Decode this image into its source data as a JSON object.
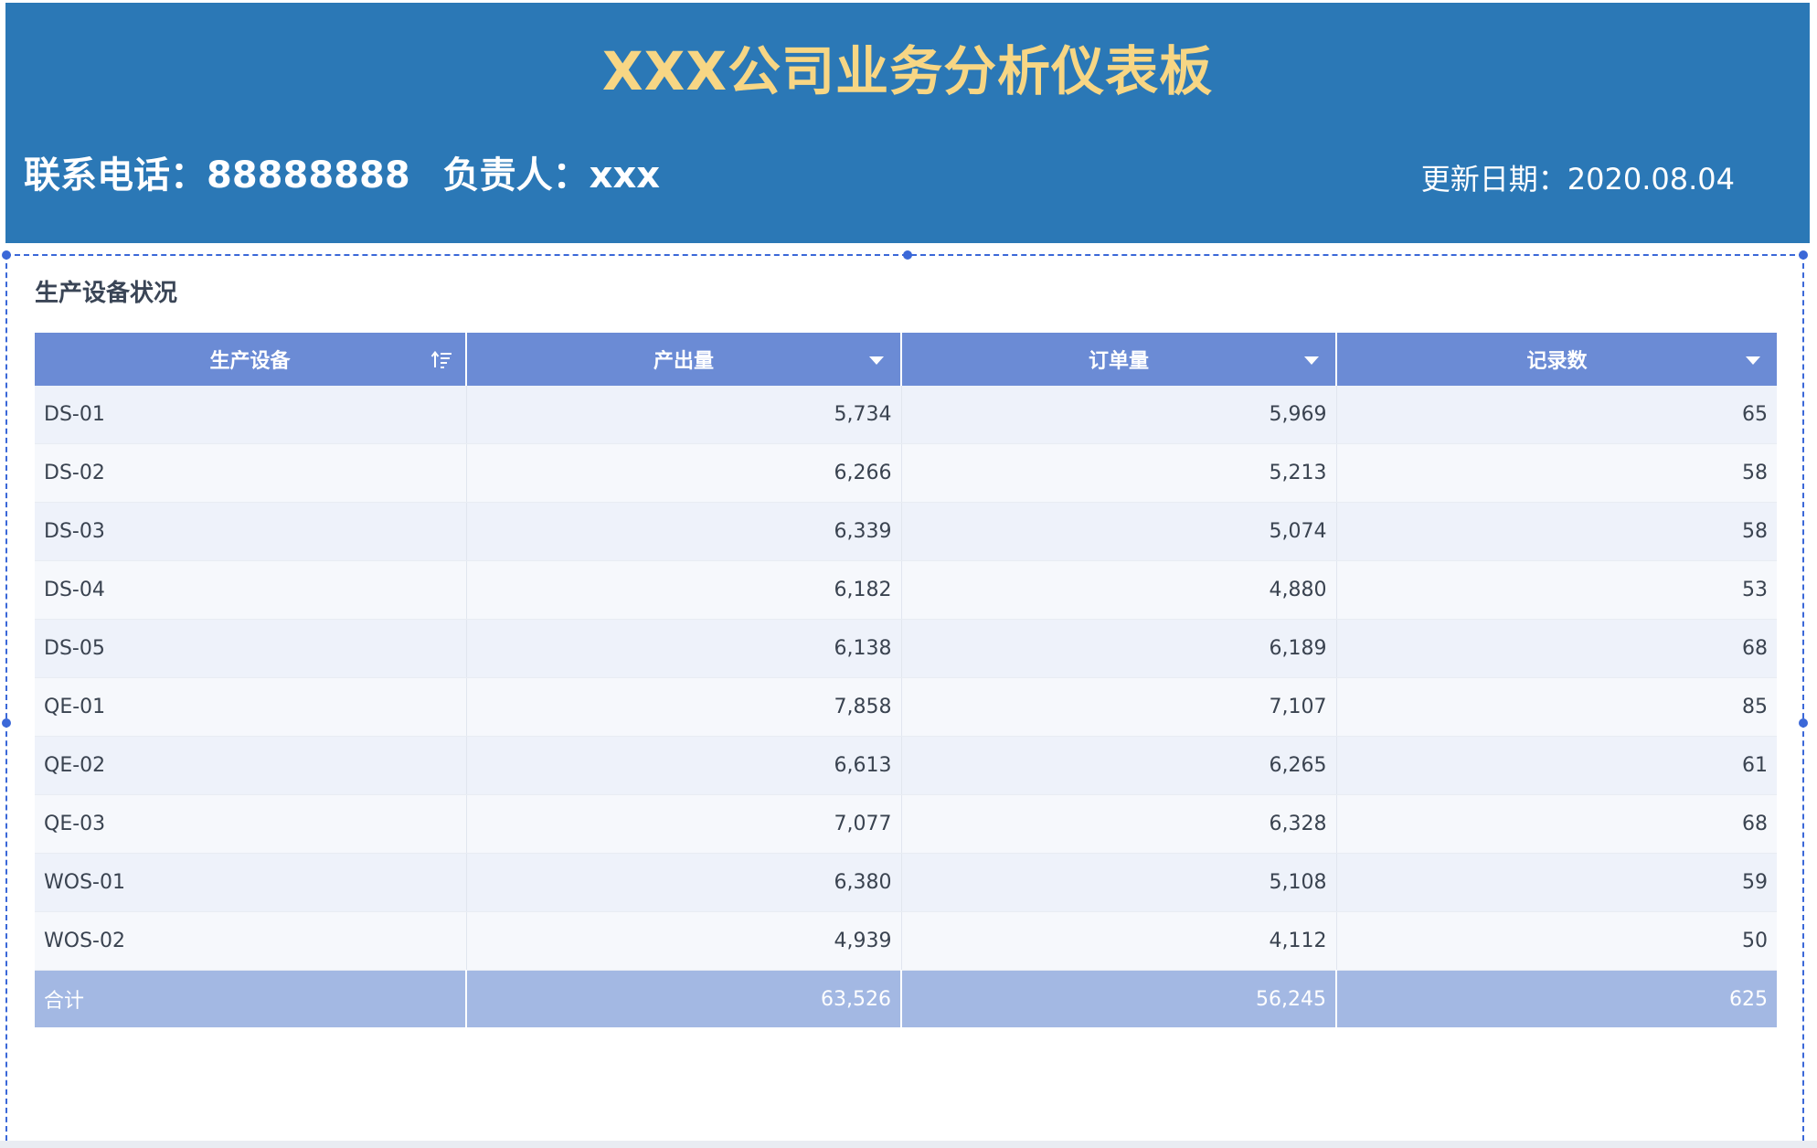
{
  "header": {
    "title": "XXX公司业务分析仪表板",
    "phone": "联系电话：88888888",
    "owner": "负责人：xxx",
    "update_date": "更新日期：2020.08.04"
  },
  "widget": {
    "title": "生产设备状况"
  },
  "table": {
    "columns": [
      {
        "label": "生产设备",
        "icon": "sort-icon"
      },
      {
        "label": "产出量",
        "icon": "dropdown-icon"
      },
      {
        "label": "订单量",
        "icon": "dropdown-icon"
      },
      {
        "label": "记录数",
        "icon": "dropdown-icon"
      }
    ],
    "rows": [
      [
        "DS-01",
        "5,734",
        "5,969",
        "65"
      ],
      [
        "DS-02",
        "6,266",
        "5,213",
        "58"
      ],
      [
        "DS-03",
        "6,339",
        "5,074",
        "58"
      ],
      [
        "DS-04",
        "6,182",
        "4,880",
        "53"
      ],
      [
        "DS-05",
        "6,138",
        "6,189",
        "68"
      ],
      [
        "QE-01",
        "7,858",
        "7,107",
        "85"
      ],
      [
        "QE-02",
        "6,613",
        "6,265",
        "61"
      ],
      [
        "QE-03",
        "7,077",
        "6,328",
        "68"
      ],
      [
        "WOS-01",
        "6,380",
        "5,108",
        "59"
      ],
      [
        "WOS-02",
        "4,939",
        "4,112",
        "50"
      ]
    ],
    "total": [
      "合计",
      "63,526",
      "56,245",
      "625"
    ]
  },
  "colors": {
    "header_bg": "#2b78b6",
    "title_color": "#f7d684",
    "table_header_bg": "#6b8bd5",
    "total_row_bg": "#a3b8e3",
    "selection_color": "#3b68d8"
  }
}
